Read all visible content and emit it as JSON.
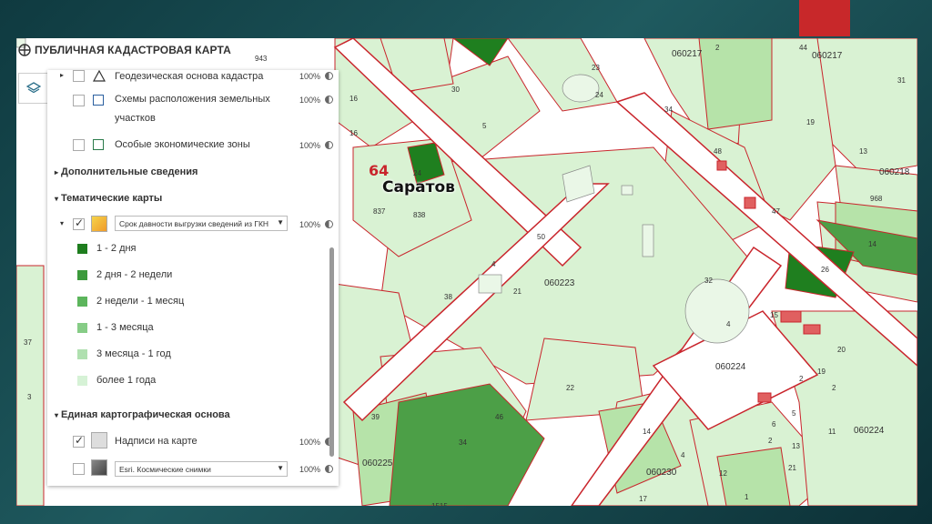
{
  "header": {
    "title": "ПУБЛИЧНАЯ КАДАСТРОВАЯ КАРТА"
  },
  "layers": {
    "geodesic": {
      "label": "Геодезическая основа кадастра",
      "opacity": "100%"
    },
    "schemes": {
      "label_line1": "Схемы расположения земельных",
      "label_line2": "участков",
      "opacity": "100%"
    },
    "econ_zones": {
      "label": "Особые экономические зоны",
      "opacity": "100%"
    }
  },
  "sections": {
    "additional": "Дополнительные сведения",
    "thematic": "Тематические карты",
    "base": "Единая картографическая основа"
  },
  "thematic_layer": {
    "select_value": "Срок давности выгрузки сведений из ГКН",
    "opacity": "100%"
  },
  "legend": [
    {
      "label": "1 - 2 дня",
      "color": "#1e7d1e"
    },
    {
      "label": "2 дня - 2 недели",
      "color": "#3c9a3c"
    },
    {
      "label": "2 недели - 1 месяц",
      "color": "#5cb55c"
    },
    {
      "label": "1 - 3 месяца",
      "color": "#86cc86"
    },
    {
      "label": "3 месяца - 1 год",
      "color": "#b0e0b0"
    },
    {
      "label": "более 1 года",
      "color": "#d6f2d6"
    }
  ],
  "base_layers": {
    "labels": {
      "label": "Надписи на карте",
      "opacity": "100%"
    },
    "satellite": {
      "select_value": "Esri. Космические снимки",
      "opacity": "100%"
    }
  },
  "map": {
    "city_code": "64",
    "city_name": "Саратов",
    "quarters": [
      "060217",
      "060217",
      "060218",
      "060223",
      "060224",
      "060224",
      "060225",
      "060230"
    ],
    "parcels": [
      "943",
      "30",
      "5",
      "23",
      "24",
      "34",
      "2",
      "44",
      "19",
      "48",
      "31",
      "13",
      "968",
      "14",
      "26",
      "47",
      "24",
      "838",
      "837",
      "50",
      "4",
      "21",
      "38",
      "32",
      "22",
      "46",
      "39",
      "34",
      "4",
      "14",
      "12",
      "17",
      "1",
      "11",
      "37",
      "3",
      "32",
      "16",
      "16",
      "15",
      "4",
      "2",
      "19",
      "6",
      "5",
      "2",
      "20",
      "13",
      "2",
      "21",
      "1515"
    ]
  },
  "colors": {
    "parcel_border": "#c9252c",
    "map_bg": "#ffffff",
    "parcel_light": "#d9f2d3",
    "parcel_mid": "#b6e3a9",
    "parcel_dark": "#4c9f47",
    "parcel_darkest": "#1f7f1f"
  }
}
